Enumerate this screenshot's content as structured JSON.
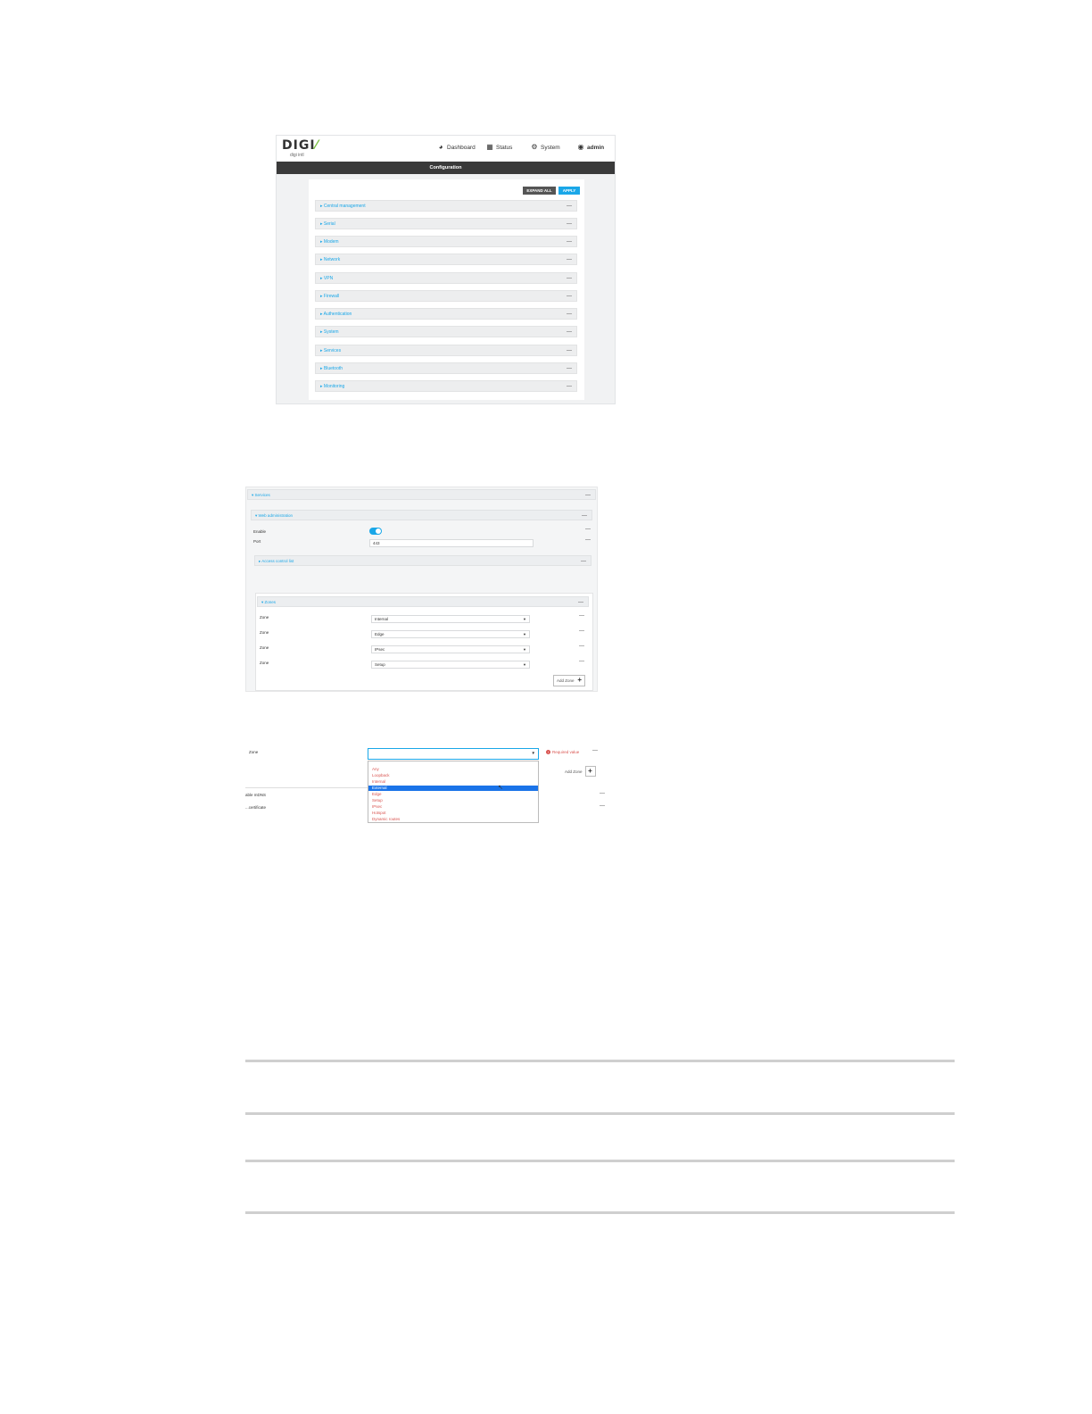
{
  "shot1": {
    "logo": "DIGI",
    "logo_sub": "digi intl",
    "nav": {
      "dashboard": "Dashboard",
      "status": "Status",
      "system": "System",
      "admin": "admin"
    },
    "title": "Configuration",
    "buttons": {
      "expand_all": "EXPAND ALL",
      "apply": "APPLY"
    },
    "sections": [
      "Central management",
      "Serial",
      "Modem",
      "Network",
      "VPN",
      "Firewall",
      "Authentication",
      "System",
      "Services",
      "Bluetooth",
      "Monitoring"
    ],
    "collapse_glyph": "—"
  },
  "shot2": {
    "services_label": "Services",
    "web_admin_label": "Web administration",
    "enable_label": "Enable",
    "port_label": "Port",
    "port_value": "443",
    "acl_label": "Access control list",
    "zones_label": "Zones",
    "zone_label": "Zone",
    "zones": [
      "Internal",
      "Edge",
      "IPsec",
      "Setup"
    ],
    "add_zone": "Add Zone"
  },
  "shot3": {
    "zone_label": "Zone",
    "required": "Required value",
    "add_zone": "Add Zone",
    "side_labels": [
      "able mDNS",
      "...certificate"
    ],
    "options": [
      "Any",
      "Loopback",
      "Internal",
      "External",
      "Edge",
      "Setup",
      "IPsec",
      "Hotspot",
      "Dynamic routes"
    ],
    "selected_index": 3
  },
  "colors": {
    "accent": "#1aa7e8",
    "title_bar": "#3a3a3a",
    "error": "#d9534f",
    "selected": "#1a73e8",
    "logo_slash": "#7cc142"
  },
  "icons": {
    "dashboard": "dashboard-gauge-icon",
    "status": "status-grid-icon",
    "system": "gear-icon",
    "admin": "user-circle-icon"
  }
}
